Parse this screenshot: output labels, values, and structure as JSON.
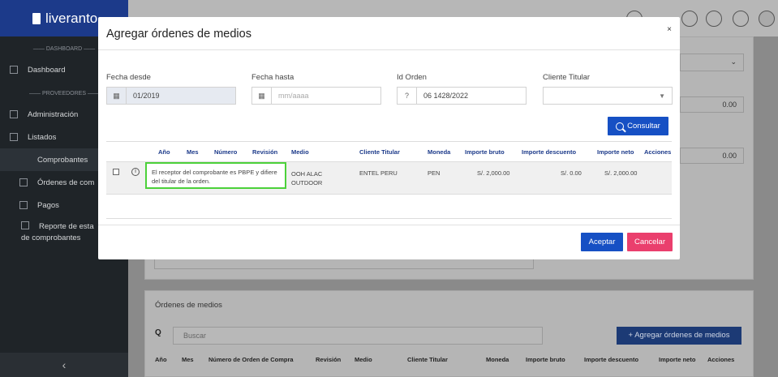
{
  "app": {
    "brand": "liveranto"
  },
  "sidebar": {
    "section_dashboard": "DASHBOARD",
    "dashboard": "Dashboard",
    "section_proveedores": "PROVEEDORES",
    "administracion": "Administración",
    "listados": "Listados",
    "comprobantes": "Comprobantes",
    "ordenes": "Órdenes de com",
    "pagos": "Pagos",
    "reporte_line1": "Reporte de esta",
    "reporte_line2": "de comprobantes",
    "collapse_icon": "chevron-left-icon",
    "collapse_glyph": "‹"
  },
  "background": {
    "amount1": "0.00",
    "amount2": "0.00",
    "section_title": "Órdenes de medios",
    "search_placeholder": "Buscar",
    "add_button": "+ Agregar órdenes de medios",
    "headers": [
      "Año",
      "Mes",
      "Número de Orden de Compra",
      "Revisión",
      "Medio",
      "Cliente Titular",
      "Moneda",
      "Importe bruto",
      "Importe descuento",
      "Importe neto",
      "Acciones"
    ]
  },
  "modal": {
    "title": "Agregar órdenes de medios",
    "close": "×",
    "filters": {
      "fecha_desde_label": "Fecha desde",
      "fecha_desde_value": "01/2019",
      "fecha_hasta_label": "Fecha hasta",
      "fecha_hasta_placeholder": "mm/aaaa",
      "id_orden_label": "Id Orden",
      "id_orden_value": "06 1428/2022",
      "cliente_label": "Cliente Titular",
      "cliente_value": ""
    },
    "consultar": "Consultar",
    "table": {
      "headers": [
        "Año",
        "Mes",
        "Número",
        "Revisión",
        "Medio",
        "Cliente Titular",
        "Moneda",
        "Importe bruto",
        "Importe descuento",
        "Importe neto",
        "Acciones"
      ],
      "row": {
        "tooltip": "El receptor del comprobante es PBPE y difiere del titular de la orden.",
        "medio_line1": "OOH ALAC",
        "medio_line2": "OUTDOOR",
        "cliente": "ENTEL PERU",
        "moneda": "PEN",
        "importe_bruto": "S/. 2,000.00",
        "importe_descuento": "S/. 0.00",
        "importe_neto": "S/. 2,000.00"
      }
    },
    "aceptar": "Aceptar",
    "cancelar": "Cancelar"
  }
}
